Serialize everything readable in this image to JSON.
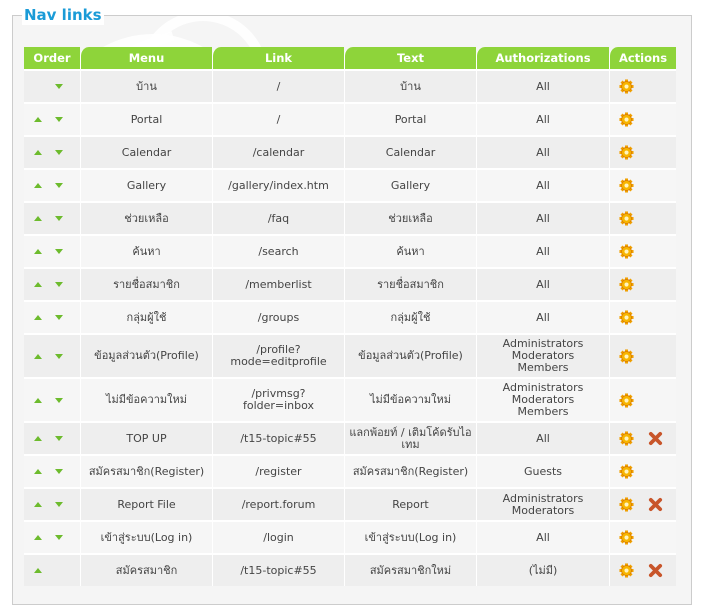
{
  "fieldset": {
    "legend": "Nav links"
  },
  "colors": {
    "header_bg": "#8ed43a",
    "legend": "#1a9bd7",
    "arrow": "#6dbb2d",
    "gear": "#f0a000",
    "delete": "#c8552a"
  },
  "table": {
    "headers": {
      "order": "Order",
      "menu": "Menu",
      "link": "Link",
      "text": "Text",
      "auth": "Authorizations",
      "actions": "Actions"
    },
    "rows": [
      {
        "menu": "บ้าน",
        "link": [
          "/"
        ],
        "text": [
          "บ้าน"
        ],
        "auth": [
          "All"
        ],
        "up": false,
        "down": true,
        "delete": false
      },
      {
        "menu": "Portal",
        "link": [
          "/"
        ],
        "text": [
          "Portal"
        ],
        "auth": [
          "All"
        ],
        "up": true,
        "down": true,
        "delete": false
      },
      {
        "menu": "Calendar",
        "link": [
          "/calendar"
        ],
        "text": [
          "Calendar"
        ],
        "auth": [
          "All"
        ],
        "up": true,
        "down": true,
        "delete": false
      },
      {
        "menu": "Gallery",
        "link": [
          "/gallery/index.htm"
        ],
        "text": [
          "Gallery"
        ],
        "auth": [
          "All"
        ],
        "up": true,
        "down": true,
        "delete": false
      },
      {
        "menu": "ช่วยเหลือ",
        "link": [
          "/faq"
        ],
        "text": [
          "ช่วยเหลือ"
        ],
        "auth": [
          "All"
        ],
        "up": true,
        "down": true,
        "delete": false
      },
      {
        "menu": "ค้นหา",
        "link": [
          "/search"
        ],
        "text": [
          "ค้นหา"
        ],
        "auth": [
          "All"
        ],
        "up": true,
        "down": true,
        "delete": false
      },
      {
        "menu": "รายชื่อสมาชิก",
        "link": [
          "/memberlist"
        ],
        "text": [
          "รายชื่อสมาชิก"
        ],
        "auth": [
          "All"
        ],
        "up": true,
        "down": true,
        "delete": false
      },
      {
        "menu": "กลุ่มผู้ใช้",
        "link": [
          "/groups"
        ],
        "text": [
          "กลุ่มผู้ใช้"
        ],
        "auth": [
          "All"
        ],
        "up": true,
        "down": true,
        "delete": false
      },
      {
        "menu": "ข้อมูลส่วนตัว(Profile)",
        "link": [
          "/profile?",
          "mode=editprofile"
        ],
        "text": [
          "ข้อมูลส่วนตัว(Profile)"
        ],
        "auth": [
          "Administrators",
          "Moderators",
          "Members"
        ],
        "up": true,
        "down": true,
        "delete": false
      },
      {
        "menu": "ไม่มีข้อความใหม่",
        "link": [
          "/privmsg?",
          "folder=inbox"
        ],
        "text": [
          "ไม่มีข้อความใหม่"
        ],
        "auth": [
          "Administrators",
          "Moderators",
          "Members"
        ],
        "up": true,
        "down": true,
        "delete": false
      },
      {
        "menu": "TOP UP",
        "link": [
          "/t15-topic#55"
        ],
        "text": [
          "แลกพ้อยท์ / เติมโค้ดรับไอ",
          "เทม"
        ],
        "auth": [
          "All"
        ],
        "up": true,
        "down": true,
        "delete": true
      },
      {
        "menu": "สมัครสมาชิก(Register)",
        "link": [
          "/register"
        ],
        "text": [
          "สมัครสมาชิก(Register)"
        ],
        "auth": [
          "Guests"
        ],
        "up": true,
        "down": true,
        "delete": false
      },
      {
        "menu": "Report File",
        "link": [
          "/report.forum"
        ],
        "text": [
          "Report"
        ],
        "auth": [
          "Administrators",
          "Moderators"
        ],
        "up": true,
        "down": true,
        "delete": true
      },
      {
        "menu": "เข้าสู่ระบบ(Log in)",
        "link": [
          "/login"
        ],
        "text": [
          "เข้าสู่ระบบ(Log in)"
        ],
        "auth": [
          "All"
        ],
        "up": true,
        "down": true,
        "delete": false
      },
      {
        "menu": "สมัครสมาชิก",
        "link": [
          "/t15-topic#55"
        ],
        "text": [
          "สมัครสมาชิกใหม่"
        ],
        "auth": [
          "(ไม่มี)"
        ],
        "up": true,
        "down": false,
        "delete": true
      }
    ]
  },
  "icons": {
    "move_up": "triangle-up-icon",
    "move_down": "triangle-down-icon",
    "edit": "gear-icon",
    "delete": "cross-icon"
  }
}
